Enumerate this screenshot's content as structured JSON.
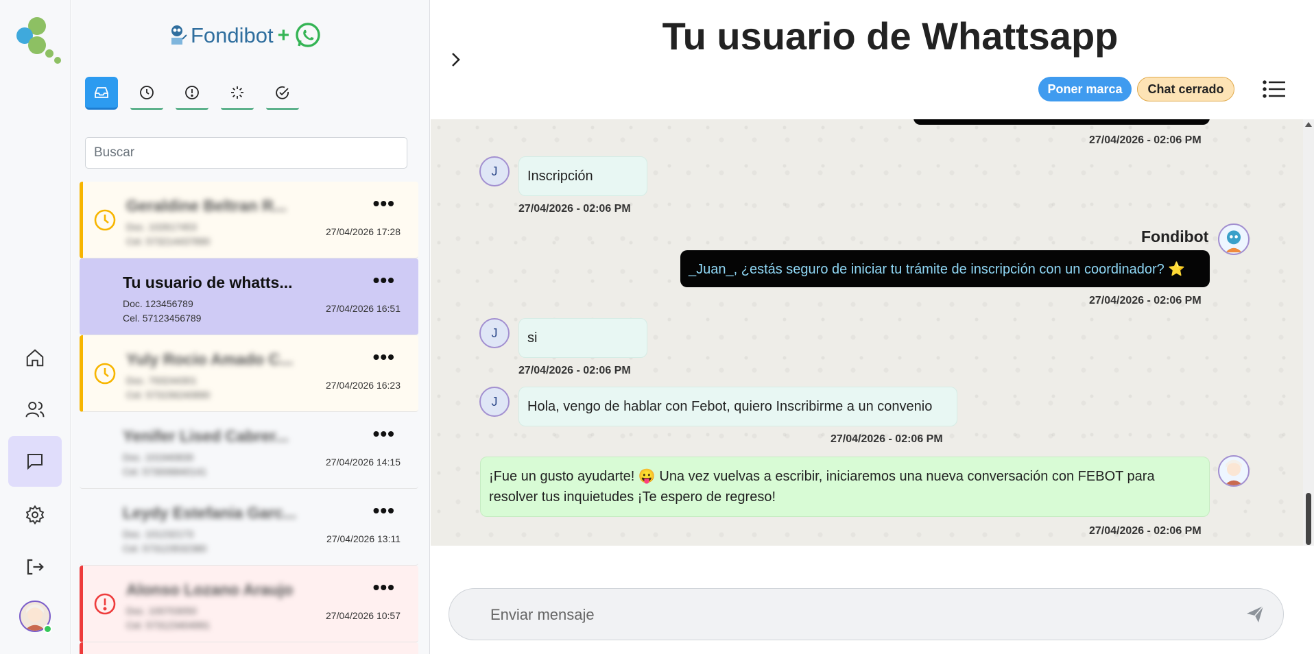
{
  "rail": {
    "items": [
      {
        "icon": "home-icon"
      },
      {
        "icon": "users-icon"
      },
      {
        "icon": "chat-icon",
        "active": true
      },
      {
        "icon": "gear-icon"
      },
      {
        "icon": "logout-icon"
      }
    ]
  },
  "brand": {
    "name": "Fondibot",
    "plus": "+"
  },
  "filters": [
    {
      "icon": "inbox-icon",
      "active": true
    },
    {
      "icon": "clock-icon"
    },
    {
      "icon": "alert-icon"
    },
    {
      "icon": "loader-icon"
    },
    {
      "icon": "check-circle-icon"
    }
  ],
  "search": {
    "placeholder": "Buscar"
  },
  "conversations": [
    {
      "status": "pending",
      "name": "Geraldine Beltran R...",
      "doc": "Doc. 102617453",
      "cel": "Cel. 573214437890",
      "date": "27/04/2026 17:28",
      "blurred": true
    },
    {
      "status": "selected",
      "name": "Tu usuario de whatts...",
      "doc": "Doc. 123456789",
      "cel": "Cel. 57123456789",
      "date": "27/04/2026 16:51",
      "blurred": false
    },
    {
      "status": "pending",
      "name": "Yuly Rocio Amado C...",
      "doc": "Doc. 793244301",
      "cel": "Cel. 573156240890",
      "date": "27/04/2026 16:23",
      "blurred": true
    },
    {
      "status": "plain",
      "name": "Yenifer Lised Cabrer...",
      "doc": "Doc. 101940839",
      "cel": "Cel. 573006840141",
      "date": "27/04/2026 14:15",
      "blurred": true
    },
    {
      "status": "plain",
      "name": "Leydy Estefania Garc...",
      "doc": "Doc. 101232173",
      "cel": "Cel. 573123532380",
      "date": "27/04/2026 13:11",
      "blurred": true
    },
    {
      "status": "alert",
      "name": "Alonso Lozano Araujo",
      "doc": "Doc. 100703050",
      "cel": "Cel. 573123404991",
      "date": "27/04/2026 10:57",
      "blurred": true
    }
  ],
  "more_label": "•••",
  "header": {
    "title": "Tu usuario de Whattsapp",
    "mark_label": "Poner marca",
    "closed_label": "Chat cerrado"
  },
  "messages": {
    "ts0": "27/04/2026 - 02:06 PM",
    "m1": {
      "avatar": "J",
      "text": "Inscripción",
      "ts": "27/04/2026 - 02:06 PM"
    },
    "m2": {
      "sender": "Fondibot",
      "text": "_Juan_, ¿estás seguro de iniciar tu trámite de inscripción con un coordinador? ⭐",
      "ts": "27/04/2026 - 02:06 PM"
    },
    "m3": {
      "avatar": "J",
      "text": "si",
      "ts": "27/04/2026 - 02:06 PM"
    },
    "m4": {
      "avatar": "J",
      "text": "Hola, vengo de hablar con Febot, quiero Inscribirme a un convenio",
      "ts": "27/04/2026 - 02:06 PM"
    },
    "m5": {
      "text": "¡Fue un gusto ayudarte! 😛 Una vez vuelvas a escribir, iniciaremos una nueva conversación con FEBOT para resolver tus inquietudes ¡Te espero de regreso!",
      "ts": "27/04/2026 - 02:06 PM"
    }
  },
  "composer": {
    "placeholder": "Enviar mensaje"
  },
  "colors": {
    "accent": "#2c9bf0",
    "pending": "#f7b500",
    "alert": "#ee3b3b",
    "selected": "#cfcbf5",
    "bot_bubble": "#050505",
    "agent_bubble": "#d8fbd5"
  }
}
